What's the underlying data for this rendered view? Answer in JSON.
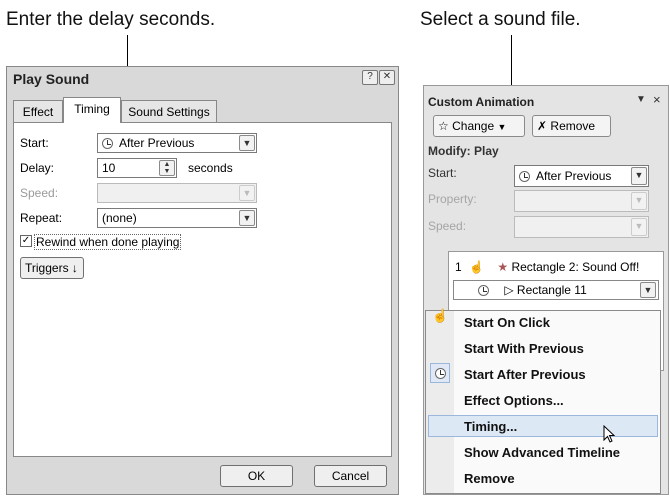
{
  "callouts": {
    "left": "Enter the delay seconds.",
    "right": "Select a sound file."
  },
  "dialog": {
    "title": "Play Sound",
    "help_btn": "?",
    "close_btn": "✕",
    "tabs": [
      "Effect",
      "Timing",
      "Sound Settings"
    ],
    "fields": {
      "start_label": "Start:",
      "start_value": "After Previous",
      "delay_label": "Delay:",
      "delay_value": "10",
      "delay_unit": "seconds",
      "speed_label": "Speed:",
      "repeat_label": "Repeat:",
      "repeat_value": "(none)",
      "rewind_label": "Rewind when done playing"
    },
    "triggers_btn": "Triggers",
    "ok_btn": "OK",
    "cancel_btn": "Cancel"
  },
  "pane": {
    "title": "Custom Animation",
    "change_btn": "Change",
    "remove_btn": "Remove",
    "modify_label": "Modify: Play",
    "start_label": "Start:",
    "start_value": "After Previous",
    "property_label": "Property:",
    "speed_label": "Speed:",
    "items": [
      {
        "index": "1",
        "label": "Rectangle 2: Sound Off!"
      },
      {
        "index": "",
        "label": "Rectangle 11"
      }
    ]
  },
  "menu": {
    "items": [
      "Start On Click",
      "Start With Previous",
      "Start After Previous",
      "Effect Options...",
      "Timing...",
      "Show Advanced Timeline",
      "Remove"
    ]
  }
}
